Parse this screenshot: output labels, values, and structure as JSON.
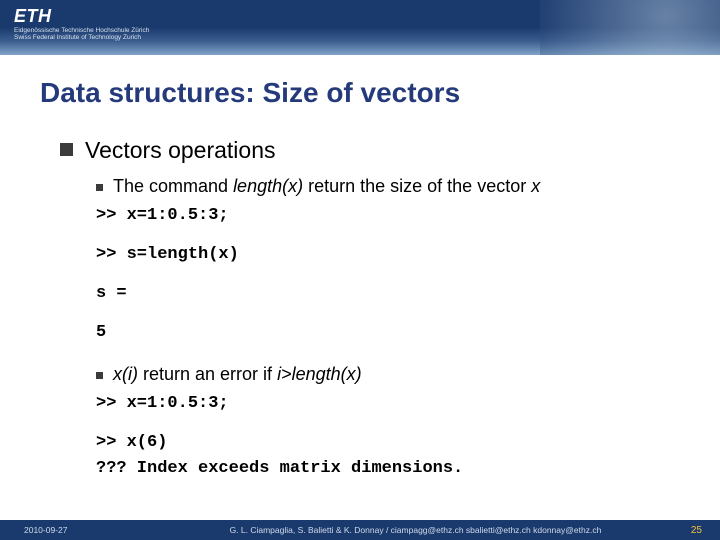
{
  "header": {
    "logo": "ETH",
    "sub1": "Eidgenössische Technische Hochschule Zürich",
    "sub2": "Swiss Federal Institute of Technology Zurich"
  },
  "title": "Data structures: Size of vectors",
  "section": {
    "heading": "Vectors operations",
    "item1_pre": "The command ",
    "item1_cmd": "length(x)",
    "item1_mid": " return the size of the vector ",
    "item1_var": "x",
    "code1_l1": ">> x=1:0.5:3;",
    "code1_l2": ">> s=length(x)",
    "code1_l3": "s =",
    "code1_l4": "5",
    "item2_cmd": "x(i)",
    "item2_mid": " return an error if ",
    "item2_cond": "i>length(x)",
    "code2_l1": ">> x=1:0.5:3;",
    "code2_l2": ">> x(6)",
    "code2_l3": "??? Index exceeds matrix dimensions."
  },
  "footer": {
    "date": "2010-09-27",
    "credits": "G. L. Ciampaglia, S. Balietti & K. Donnay / ciampagg@ethz.ch sbalietti@ethz.ch kdonnay@ethz.ch",
    "page": "25"
  }
}
